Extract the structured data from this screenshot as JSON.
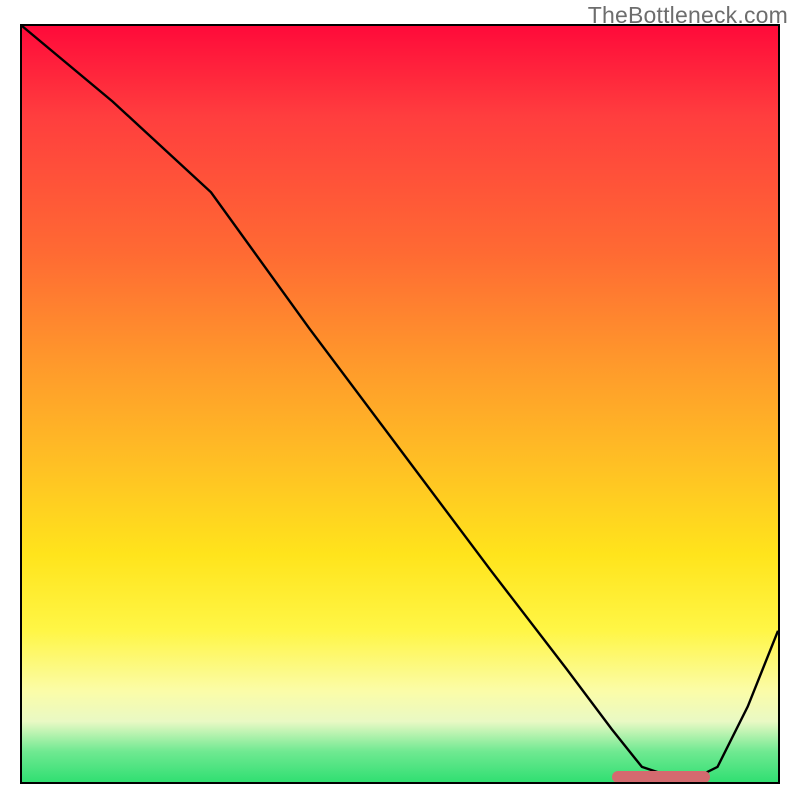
{
  "watermark_text": "TheBottleneck.com",
  "colors": {
    "border": "#000000",
    "curve": "#000000",
    "marker": "#d46a6f",
    "watermark": "#6d6d6d"
  },
  "chart_data": {
    "type": "line",
    "title": "",
    "xlabel": "",
    "ylabel": "",
    "xlim": [
      0,
      100
    ],
    "ylim": [
      0,
      100
    ],
    "curve": {
      "x": [
        0,
        12,
        25,
        38,
        50,
        62,
        72,
        78,
        82,
        88,
        92,
        96,
        100
      ],
      "y": [
        100,
        90,
        78,
        60,
        44,
        28,
        15,
        7,
        2,
        0,
        2,
        10,
        20
      ]
    },
    "optimal_segment": {
      "x_start": 78,
      "x_end": 91,
      "y": 0.6
    },
    "annotations": []
  }
}
